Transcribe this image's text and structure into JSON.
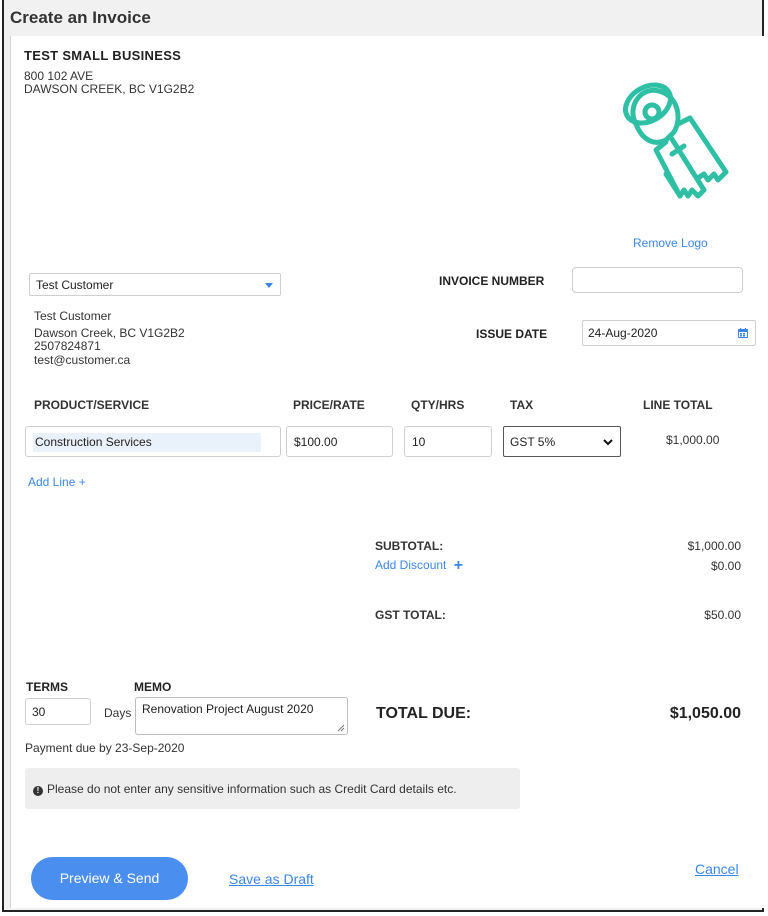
{
  "window": {
    "title": "Create an Invoice"
  },
  "business": {
    "name": "TEST SMALL BUSINESS",
    "address_line1": "800 102 AVE",
    "address_line2": "DAWSON CREEK, BC V1G2B2"
  },
  "logo": {
    "icon": "keys-icon",
    "color": "#2ebfa5",
    "remove_label": "Remove Logo"
  },
  "customer": {
    "selected": "Test Customer",
    "name": "Test Customer",
    "city_line": "Dawson Creek, BC V1G2B2",
    "phone": "2507824871",
    "email": "test@customer.ca"
  },
  "invoice": {
    "number_label": "INVOICE NUMBER",
    "number_value": "",
    "issue_date_label": "ISSUE DATE",
    "issue_date_value": "24-Aug-2020"
  },
  "line_items": {
    "headers": [
      "PRODUCT/SERVICE",
      "PRICE/RATE",
      "QTY/HRS",
      "TAX",
      "LINE TOTAL"
    ],
    "rows": [
      {
        "product": "Construction Services",
        "price": "$100.00",
        "qty": "10",
        "tax": "GST 5%",
        "line_total": "$1,000.00"
      }
    ],
    "add_line_label": "Add Line +"
  },
  "summary": {
    "subtotal_label": "SUBTOTAL:",
    "subtotal_value": "$1,000.00",
    "discount_label": "Add Discount",
    "discount_value": "$0.00",
    "gst_label": "GST TOTAL:",
    "gst_value": "$50.00",
    "total_due_label": "TOTAL DUE:",
    "total_due_value": "$1,050.00"
  },
  "terms": {
    "terms_label": "TERMS",
    "terms_value": "30",
    "days_label": "Days",
    "memo_label": "MEMO",
    "memo_value": "Renovation Project August 2020",
    "payment_due": "Payment due by 23-Sep-2020"
  },
  "notice": {
    "text": "Please do not enter any sensitive information such as Credit Card details etc."
  },
  "actions": {
    "preview_label": "Preview & Send",
    "draft_label": "Save as Draft",
    "cancel_label": "Cancel"
  },
  "colors": {
    "accent": "#3a86e8",
    "button": "#4a8ef0",
    "logo": "#2ebfa5"
  }
}
